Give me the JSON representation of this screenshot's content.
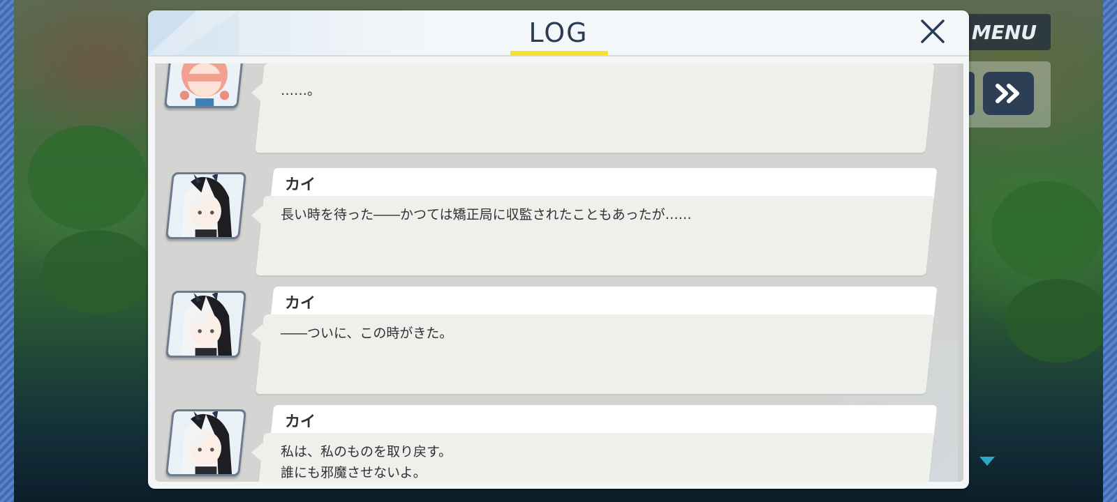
{
  "log_panel": {
    "title": "LOG",
    "accent_color": "#f4e232",
    "close_icon": "close-x-icon"
  },
  "background_ui": {
    "menu_label": "MENU",
    "fast_forward_icon": "double-chevron-right-icon",
    "scroll_hint_icon": "triangle-down-icon"
  },
  "entries": [
    {
      "speaker": "",
      "text": "……。",
      "avatar": "pink-hair-girl-portrait"
    },
    {
      "speaker": "カイ",
      "text": "長い時を待った――かつては矯正局に収監されたこともあったが……",
      "avatar": "kai-portrait"
    },
    {
      "speaker": "カイ",
      "text": "――ついに、この時がきた。",
      "avatar": "kai-portrait"
    },
    {
      "speaker": "カイ",
      "text": "私は、私のものを取り戻す。\n誰にも邪魔させないよ。",
      "avatar": "kai-portrait"
    }
  ]
}
